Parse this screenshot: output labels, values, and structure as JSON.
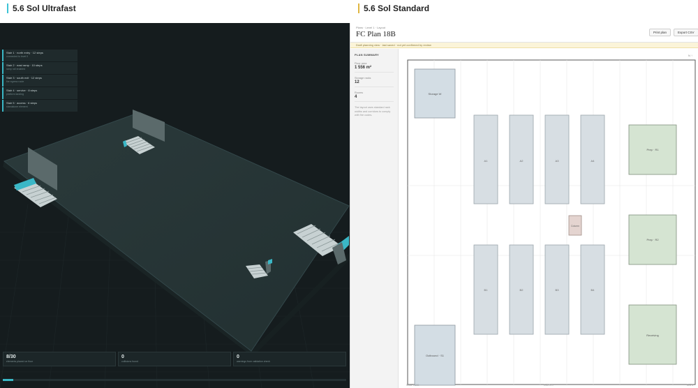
{
  "panes": {
    "left_title": "5.6 Sol Ultrafast",
    "right_title": "5.6 Sol Standard"
  },
  "left": {
    "layers": [
      {
        "title": "Stair 1 · north entry · 12 steps",
        "subtitle": "connected to level 0"
      },
      {
        "title": "Stair 2 · east ramp · 10 steps",
        "subtitle": "ramp rail enabled"
      },
      {
        "title": "Stair 3 · south exit · 12 steps",
        "subtitle": "fire egress route"
      },
      {
        "title": "Stair 4 · service · 8 steps",
        "subtitle": "platform landing"
      },
      {
        "title": "Stair 5 · access · 6 steps",
        "subtitle": "standalone element"
      }
    ],
    "stats": [
      {
        "value": "8/30",
        "caption": "elements placed on floor"
      },
      {
        "value": "0",
        "caption": "collisions found"
      },
      {
        "value": "0",
        "caption": "warnings from validation check"
      }
    ],
    "progress": 0.03
  },
  "right": {
    "breadcrumb": "Plans · Level 1 · Layout",
    "plan_title": "FC Plan 18B",
    "buttons": {
      "print": "Print plan",
      "export": "Export CSV"
    },
    "notice": "Draft planning view · last saved · not yet confirmed by review",
    "summary": {
      "heading": "PLAN SUMMARY",
      "rows": [
        {
          "label": "Floor area",
          "value": "1 556 m²"
        },
        {
          "label": "Storage racks",
          "value": "12"
        },
        {
          "label": "Rooms",
          "value": "4"
        }
      ],
      "note": "The layout uses standard rack widths and corridors to comply with fire codes."
    },
    "plan": {
      "rooms_left": [
        {
          "id": "storage",
          "label": "Storage W"
        },
        {
          "id": "outbound",
          "label": "Outbound · S1"
        }
      ],
      "rooms_right": [
        {
          "id": "prep1",
          "label": "Prep · R1"
        },
        {
          "id": "prep2",
          "label": "Prep · R2"
        },
        {
          "id": "receiving",
          "label": "Receiving"
        }
      ],
      "racks_top": [
        "A1",
        "A2",
        "A3",
        "A4"
      ],
      "racks_bottom": [
        "B1",
        "B2",
        "B3",
        "B4"
      ],
      "center_label": "Column",
      "corner_label": "N ↑",
      "footer_left": "Scale 1:200",
      "footer_mid": "Grid 5 m",
      "footer_right": "Rev 3"
    }
  }
}
